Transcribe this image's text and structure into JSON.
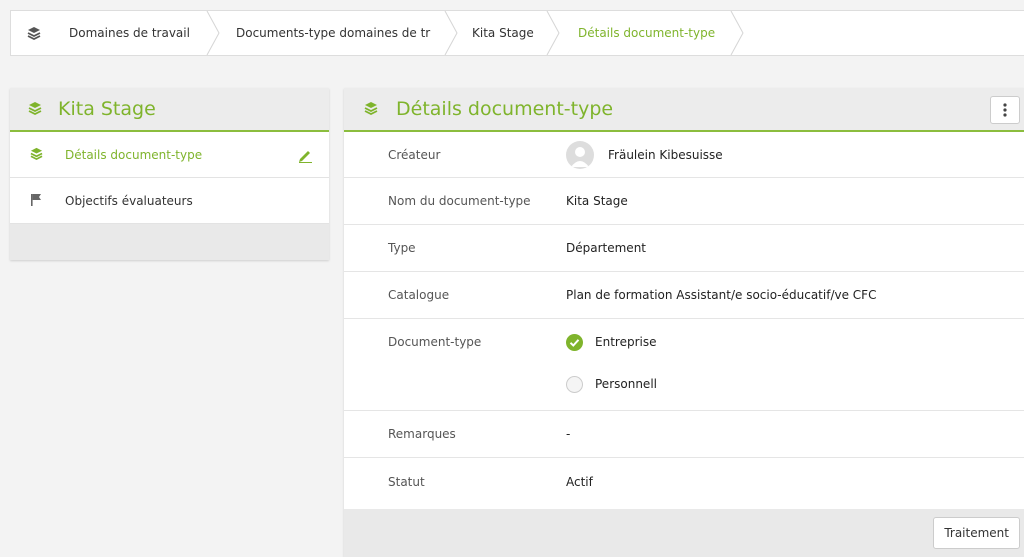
{
  "breadcrumb": {
    "items": [
      {
        "label": "Domaines de travail"
      },
      {
        "label": "Documents-type domaines de tr"
      },
      {
        "label": "Kita Stage"
      },
      {
        "label": "Détails document-type"
      }
    ]
  },
  "sidebar": {
    "title": "Kita Stage",
    "items": [
      {
        "label": "Détails document-type",
        "icon": "layers-icon",
        "active": true
      },
      {
        "label": "Objectifs évaluateurs",
        "icon": "flag-icon",
        "active": false
      }
    ]
  },
  "details": {
    "title": "Détails document-type",
    "rows": {
      "creator": {
        "key": "Créateur",
        "value": "Fräulein Kibesuisse"
      },
      "name": {
        "key": "Nom du document-type",
        "value": "Kita Stage"
      },
      "type": {
        "key": "Type",
        "value": "Département"
      },
      "catalogue": {
        "key": "Catalogue",
        "value": "Plan de formation Assistant/e socio-éducatif/ve CFC"
      },
      "doctype": {
        "key": "Document-type",
        "options": [
          {
            "label": "Entreprise",
            "checked": true
          },
          {
            "label": "Personnell",
            "checked": false
          }
        ]
      },
      "remarks": {
        "key": "Remarques",
        "value": "-"
      },
      "status": {
        "key": "Statut",
        "value": "Actif"
      }
    },
    "action_button": "Traitement"
  },
  "colors": {
    "accent": "#7fb42c",
    "panel_header": "#ececec"
  }
}
